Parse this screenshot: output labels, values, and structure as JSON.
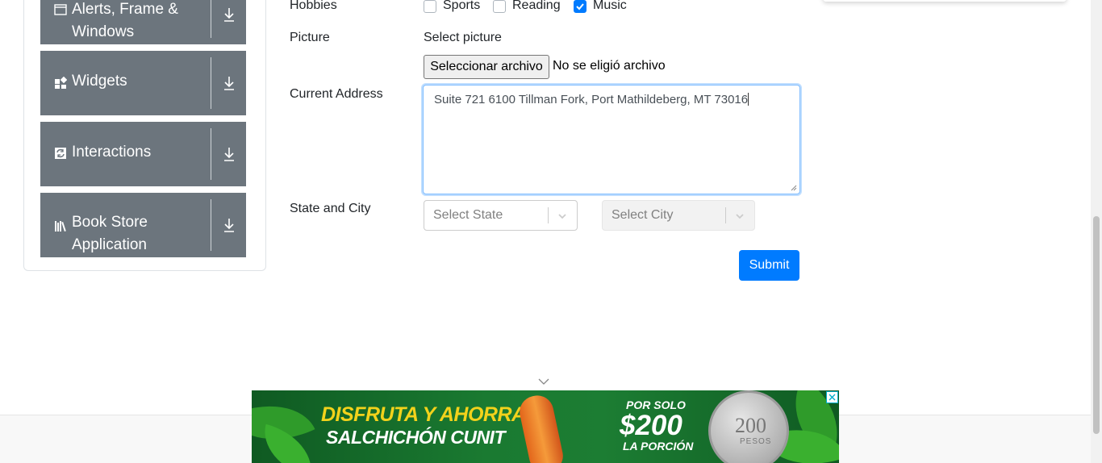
{
  "nav_groups": [
    {
      "label_line1": "Alerts, Frame &",
      "label_line2": "Windows",
      "icon": "window-icon"
    },
    {
      "label_line1": "Widgets",
      "label_line2": "",
      "icon": "widgets-icon"
    },
    {
      "label_line1": "Interactions",
      "label_line2": "",
      "icon": "interactions-icon"
    },
    {
      "label_line1": "Book Store",
      "label_line2": "Application",
      "icon": "books-icon"
    }
  ],
  "form": {
    "hobbies_label": "Hobbies",
    "hobbies": [
      {
        "label": "Sports",
        "checked": false
      },
      {
        "label": "Reading",
        "checked": false
      },
      {
        "label": "Music",
        "checked": true
      }
    ],
    "picture_label": "Picture",
    "picture_hint": "Select picture",
    "file_button": "Seleccionar archivo",
    "file_status": "No se eligió archivo",
    "address_label": "Current Address",
    "address_value": "Suite 721 6100 Tillman Fork, Port Mathildeberg, MT 73016",
    "state_city_label": "State and City",
    "state_placeholder": "Select State",
    "city_placeholder": "Select City",
    "submit_label": "Submit"
  },
  "ad": {
    "line1": "DISFRUTA Y AHORRA",
    "line2": "SALCHICHÓN CUNIT",
    "price_pre": "POR SOLO",
    "price": "$200",
    "price_post": "LA PORCIÓN",
    "coin_value": "200",
    "coin_text": "PESOS"
  },
  "colors": {
    "nav_bg": "#6c757d",
    "primary": "#007bff"
  }
}
